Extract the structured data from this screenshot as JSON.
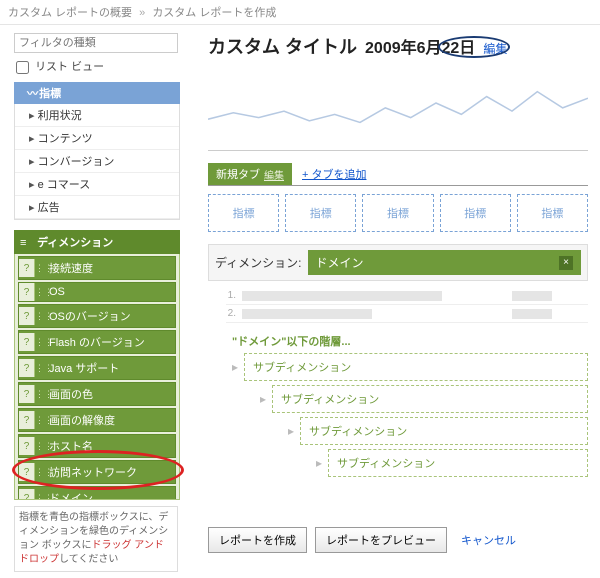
{
  "crumb": {
    "a": "カスタム レポートの概要",
    "sep": "»",
    "b": "カスタム レポートを作成"
  },
  "side": {
    "filter_placeholder": "フィルタの種類",
    "listview": "リスト ビュー",
    "metrics_header": "指標",
    "metrics": [
      "利用状況",
      "コンテンツ",
      "コンバージョン",
      "e コマース",
      "広告"
    ],
    "dim_header": "ディメンション",
    "dims": [
      "接続速度",
      "OS",
      "OSのバージョン",
      "Flash のバージョン",
      "Java サポート",
      "画面の色",
      "画面の解像度",
      "ホスト名",
      "訪問ネットワーク",
      "ドメイン"
    ],
    "hint_pre": "指標を青色の指標ボックスに、ディメンションを緑色のディメンション ボックスに",
    "hint_red": "ドラッグ アンド ドロップ",
    "hint_post": "してください"
  },
  "main": {
    "title": "カスタム タイトル",
    "date": "2009年6月22日",
    "edit": "編集",
    "tab_active": "新規タブ",
    "tab_edit": "編集",
    "tab_add": "+ タブを追加",
    "slot_label": "指標",
    "dim_label": "ディメンション:",
    "dim_value": "ドメイン",
    "sub_head": "\"ドメイン\"以下の階層...",
    "sub_label": "サブディメンション",
    "btn_create": "レポートを作成",
    "btn_preview": "レポートをプレビュー",
    "cancel": "キャンセル"
  },
  "chart_data": {
    "type": "line",
    "x": [
      0,
      1,
      2,
      3,
      4,
      5,
      6,
      7,
      8,
      9,
      10,
      11,
      12,
      13,
      14,
      15
    ],
    "values": [
      38,
      46,
      40,
      48,
      36,
      44,
      34,
      52,
      40,
      58,
      44,
      66,
      48,
      72,
      52,
      64
    ],
    "ylim": [
      0,
      100
    ]
  }
}
